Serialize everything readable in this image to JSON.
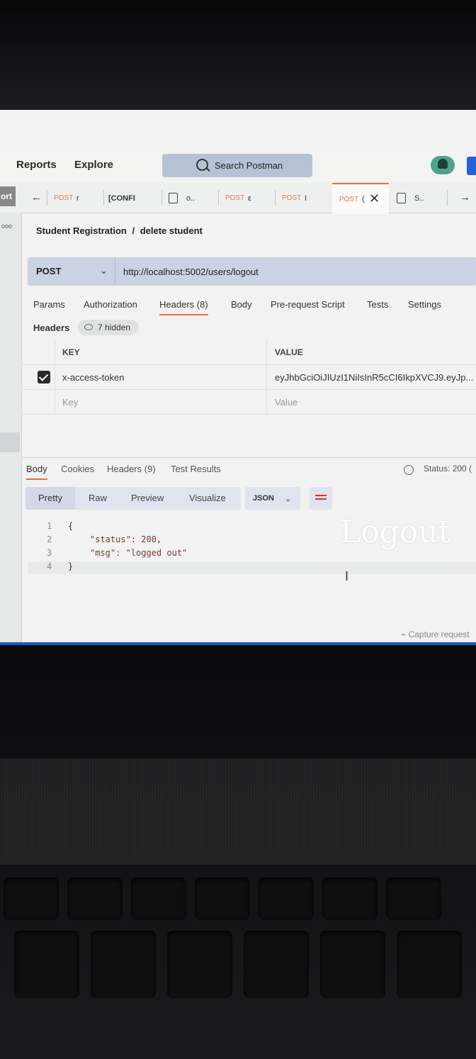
{
  "menu": {
    "reports": "Reports",
    "explore": "Explore",
    "search_placeholder": "Search Postman"
  },
  "tabs": {
    "sidebar_cut": "ort",
    "items": [
      {
        "method": "POST",
        "name": "r"
      },
      {
        "method": "",
        "name": "[CONFI"
      },
      {
        "method": "",
        "name": "o.."
      },
      {
        "method": "POST",
        "name": "ε"
      },
      {
        "method": "POST",
        "name": "I"
      },
      {
        "method": "POST",
        "name": "("
      },
      {
        "method": "",
        "name": "S.."
      }
    ]
  },
  "breadcrumb": {
    "collection": "Student Registration",
    "separator": "/",
    "request": "delete student"
  },
  "request": {
    "method": "POST",
    "url": "http://localhost:5002/users/logout"
  },
  "request_tabs": [
    "Params",
    "Authorization",
    "Headers (8)",
    "Body",
    "Pre-request Script",
    "Tests",
    "Settings"
  ],
  "headers": {
    "title": "Headers",
    "hidden": "7 hidden",
    "col_key": "KEY",
    "col_value": "VALUE",
    "rows": [
      {
        "key": "x-access-token",
        "value": "eyJhbGciOiJIUzI1NiIsInR5cCI6IkpXVCJ9.eyJp..."
      }
    ],
    "key_placeholder": "Key",
    "value_placeholder": "Value"
  },
  "response_tabs": [
    "Body",
    "Cookies",
    "Headers (9)",
    "Test Results"
  ],
  "status": "Status: 200 (",
  "view_modes": [
    "Pretty",
    "Raw",
    "Preview",
    "Visualize"
  ],
  "format": "JSON",
  "code_lines": [
    {
      "n": "1",
      "text": "{"
    },
    {
      "n": "2",
      "text": "\"status\": 200,"
    },
    {
      "n": "3",
      "text": "\"msg\": \"logged out\""
    },
    {
      "n": "4",
      "text": "}"
    }
  ],
  "overlay_text": "Logout",
  "capture": "Capture request",
  "colors": {
    "accent": "#f06d3a",
    "taskbar_line": "#1a5fc4"
  },
  "taskbar_icons": [
    "search-circle-icon",
    "task-view-icon",
    "edge-icon",
    "file-explorer-icon",
    "mail-icon",
    "spotify-icon",
    "vscode-icon",
    "postman-icon"
  ]
}
